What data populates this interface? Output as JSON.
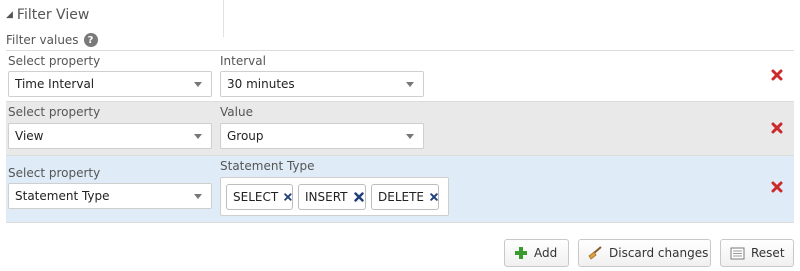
{
  "panel": {
    "title": "Filter View",
    "filter_values_label": "Filter values",
    "help_icon_text": "?"
  },
  "filters": [
    {
      "property_label": "Select property",
      "property_value": "Time Interval",
      "value_label": "Interval",
      "value": "30 minutes"
    },
    {
      "property_label": "Select property",
      "property_value": "View",
      "value_label": "Value",
      "value": "Group"
    },
    {
      "property_label": "Select property",
      "property_value": "Statement Type",
      "value_label": "Statement Type",
      "tags": [
        "SELECT",
        "INSERT",
        "DELETE"
      ]
    }
  ],
  "buttons": {
    "add": "Add",
    "discard": "Discard changes",
    "reset": "Reset"
  },
  "colors": {
    "remove_red": "#cc2a2a",
    "tag_x_navy": "#1f3f7a",
    "row_gray": "#e9e9e9",
    "row_blue": "#dfecf7"
  },
  "icons": {
    "collapse": "triangle-down-icon",
    "help": "question-circle-icon",
    "remove": "remove-x-icon",
    "tag_remove": "tag-remove-icon",
    "add": "plus-icon",
    "discard": "broom-icon",
    "reset": "reset-icon"
  }
}
